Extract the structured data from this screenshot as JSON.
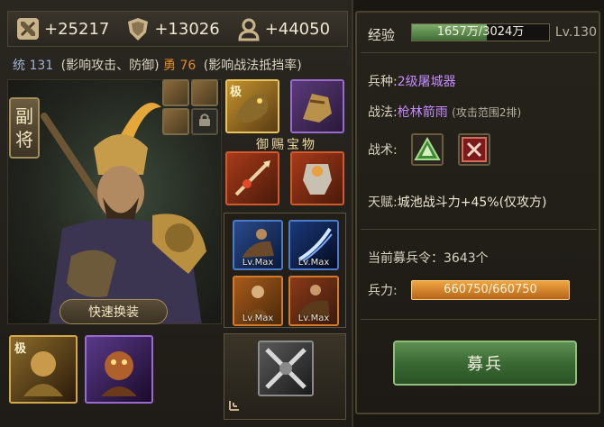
{
  "stats": {
    "attack": "+25217",
    "defense": "+13026",
    "troops": "+44050"
  },
  "attributes": {
    "lead_label": "统",
    "lead_value": "131",
    "lead_note": "(影响攻击、防御)",
    "brave_label": "勇",
    "brave_value": "76",
    "brave_note": "(影响战法抵挡率)"
  },
  "general": {
    "role_badge_line1": "副",
    "role_badge_line2": "将",
    "quick_swap_label": "快速换装"
  },
  "equipment": {
    "rare_badge": "极",
    "royal_treasure_label": "御赐宝物"
  },
  "tactic_slots": [
    {
      "label": "Lv.Max"
    },
    {
      "label": "Lv.Max"
    },
    {
      "label": "Lv.Max"
    },
    {
      "label": "Lv.Max"
    }
  ],
  "info": {
    "exp_label": "经验",
    "exp_text": "1657万/3024万",
    "exp_progress": 0.548,
    "level": "Lv.130",
    "unit_type_label": "兵种",
    "unit_type_sep": ":",
    "unit_type_value": "2级屠城器",
    "tactic_label": "战法",
    "tactic_sep": ":",
    "tactic_value": "枪林箭雨",
    "tactic_note": "(攻击范围2排)",
    "skill_label": "战术",
    "skill_sep": ":",
    "talent_label": "天赋",
    "talent_sep": ":",
    "talent_value": "城池战斗力+45%(仅攻方)",
    "recruit_order_text": "当前募兵令：3643个",
    "troop_label": "兵力",
    "troop_sep": ":",
    "troop_value": "660750/660750",
    "recruit_button": "募兵"
  },
  "colors": {
    "accent_gold": "#a38c5a",
    "purple_text": "#c58bff",
    "orange_text": "#e08a2a",
    "recruit_green": "#3a6a33",
    "troop_orange": "#f0a640"
  }
}
